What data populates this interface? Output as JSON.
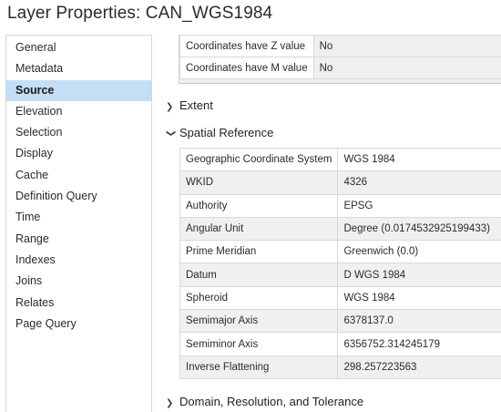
{
  "window": {
    "title": "Layer Properties: CAN_WGS1984"
  },
  "sidebar": {
    "items": [
      {
        "label": "General",
        "active": false
      },
      {
        "label": "Metadata",
        "active": false
      },
      {
        "label": "Source",
        "active": true
      },
      {
        "label": "Elevation",
        "active": false
      },
      {
        "label": "Selection",
        "active": false
      },
      {
        "label": "Display",
        "active": false
      },
      {
        "label": "Cache",
        "active": false
      },
      {
        "label": "Definition Query",
        "active": false
      },
      {
        "label": "Time",
        "active": false
      },
      {
        "label": "Range",
        "active": false
      },
      {
        "label": "Indexes",
        "active": false
      },
      {
        "label": "Joins",
        "active": false
      },
      {
        "label": "Relates",
        "active": false
      },
      {
        "label": "Page Query",
        "active": false
      }
    ]
  },
  "geometry_props": [
    {
      "key": "Coordinates have Z value",
      "value": "No"
    },
    {
      "key": "Coordinates have M value",
      "value": "No"
    }
  ],
  "sections": {
    "extent": {
      "label": "Extent",
      "icon": "chevron-right-icon"
    },
    "spatial_reference": {
      "label": "Spatial Reference",
      "icon": "chevron-down-icon"
    },
    "domain": {
      "label": "Domain, Resolution, and Tolerance",
      "icon": "chevron-right-icon"
    }
  },
  "spatial_reference": [
    {
      "key": "Geographic Coordinate System",
      "value": "WGS 1984"
    },
    {
      "key": "WKID",
      "value": "4326"
    },
    {
      "key": "Authority",
      "value": "EPSG"
    },
    {
      "key": "Angular Unit",
      "value": "Degree (0.0174532925199433)"
    },
    {
      "key": "Prime Meridian",
      "value": "Greenwich (0.0)"
    },
    {
      "key": "Datum",
      "value": "D WGS 1984"
    },
    {
      "key": "Spheroid",
      "value": "WGS 1984"
    },
    {
      "key": "Semimajor Axis",
      "value": "6378137.0"
    },
    {
      "key": "Semiminor Axis",
      "value": "6356752.314245179"
    },
    {
      "key": "Inverse Flattening",
      "value": "298.257223563"
    }
  ],
  "colors": {
    "active_item": "#c3def5",
    "row_alt": "#f0f0f0",
    "border": "#d9d9d9"
  }
}
